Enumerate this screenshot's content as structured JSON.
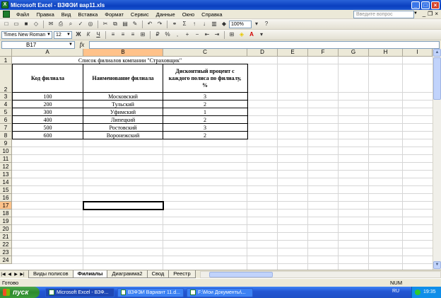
{
  "window": {
    "title": "Microsoft Excel - ВЗФЭИ вар11.xls"
  },
  "menu": {
    "items": [
      "Файл",
      "Правка",
      "Вид",
      "Вставка",
      "Формат",
      "Сервис",
      "Данные",
      "Окно",
      "Справка"
    ],
    "help_placeholder": "Введите вопрос"
  },
  "toolbar": {
    "zoom": "100%",
    "font_name": "Times New Roman",
    "font_size": "12"
  },
  "formula_bar": {
    "name_box": "B17",
    "fx": "fx",
    "formula": ""
  },
  "columns": [
    "A",
    "B",
    "C",
    "D",
    "E",
    "F",
    "G",
    "H",
    "I"
  ],
  "rows": [
    "1",
    "2",
    "3",
    "4",
    "5",
    "6",
    "7",
    "8",
    "9",
    "10",
    "11",
    "12",
    "13",
    "14",
    "15",
    "16",
    "17",
    "18",
    "19",
    "20",
    "21",
    "22",
    "23",
    "24"
  ],
  "sheet": {
    "title": "Список филиалов компании \"Страховщик\"",
    "headers": [
      "Код филиала",
      "Наименование филиала",
      "Дисконтный процент с каждого полиса по филиалу, %"
    ],
    "rows": [
      [
        "100",
        "Московский",
        "3"
      ],
      [
        "200",
        "Тульский",
        "2"
      ],
      [
        "300",
        "Уфимский",
        "1"
      ],
      [
        "400",
        "Липецкий",
        "2"
      ],
      [
        "500",
        "Ростовский",
        "3"
      ],
      [
        "600",
        "Воронежский",
        "2"
      ]
    ]
  },
  "tabs": [
    "Виды полисов",
    "Филиалы",
    "Диаграмма2",
    "Свод",
    "Реестр"
  ],
  "active_tab": "Филиалы",
  "status": {
    "left": "Готово",
    "num": "NUM"
  },
  "taskbar": {
    "start": "пуск",
    "items": [
      "Microsoft Excel - ВЗФ...",
      "ВЗФЭИ Вариант 11.d...",
      "F:\\Мои Документы\\..."
    ],
    "lang": "RU",
    "clock": "19:35"
  },
  "colors": {
    "title_bar": "#0a3fbf",
    "selection_header": "#ffc28a",
    "taskbar": "#2457d4",
    "start": "#2d8a2d"
  }
}
